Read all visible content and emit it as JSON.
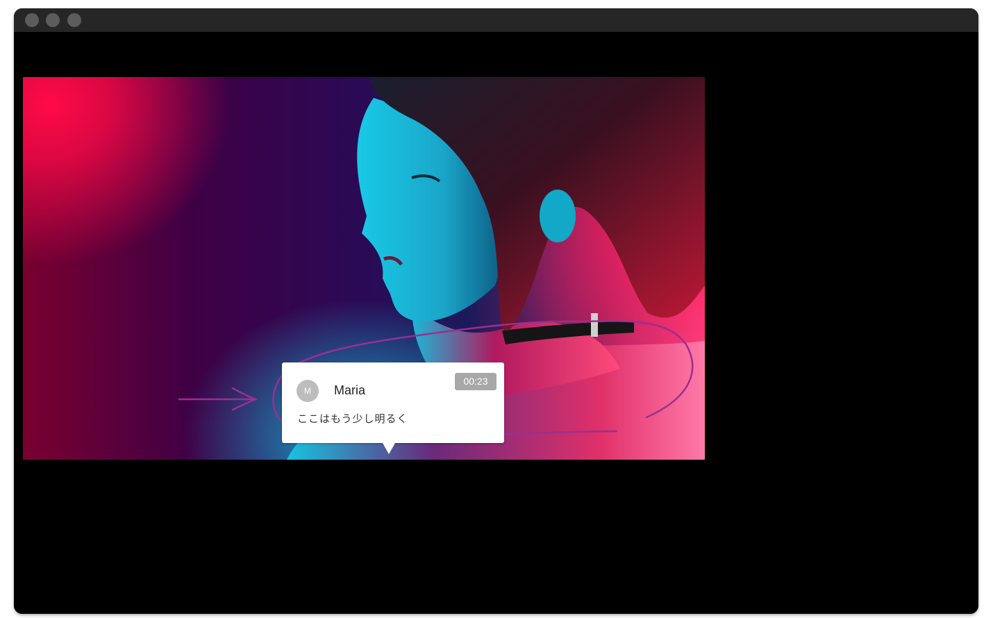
{
  "window": {
    "traffic_lights": [
      "close",
      "minimize",
      "zoom"
    ]
  },
  "comment": {
    "avatar_initial": "M",
    "username": "Maria",
    "timestamp": "00:23",
    "message": "ここはもう少し明るく"
  },
  "annotation": {
    "color": "#9b2f8f",
    "shapes": [
      "arrow",
      "freehand-loop"
    ]
  }
}
